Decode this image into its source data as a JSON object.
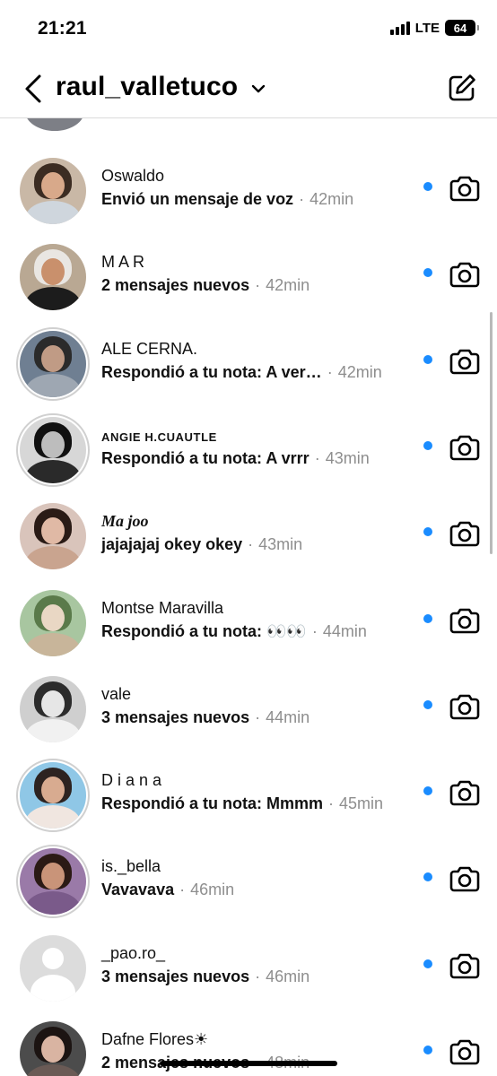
{
  "status_bar": {
    "time": "21:21",
    "network": "LTE",
    "battery": "64"
  },
  "header": {
    "title": "raul_valletuco"
  },
  "conversations": [
    {
      "name": "Oswaldo",
      "message": "Envió un mensaje de voz",
      "time": "42min"
    },
    {
      "name": "M A R",
      "message": "2 mensajes nuevos",
      "time": "42min"
    },
    {
      "name": "ALE CERNA.",
      "message": "Respondió a tu nota: A ver…",
      "time": "42min"
    },
    {
      "name": "ANGIE H.CUAUTLE",
      "message": "Respondió a tu nota: A vrrr",
      "time": "43min"
    },
    {
      "name": "Ma joo",
      "message": "jajajajaj okey okey",
      "time": "43min"
    },
    {
      "name": "Montse Maravilla",
      "message": "Respondió a tu nota: 👀👀",
      "time": "44min"
    },
    {
      "name": "vale",
      "message": "3 mensajes nuevos",
      "time": "44min"
    },
    {
      "name": "D i a n a",
      "message": "Respondió a tu nota: Mmmm",
      "time": "45min"
    },
    {
      "name": "is._bella",
      "message": "Vavavava",
      "time": "46min"
    },
    {
      "name": "_pao.ro_",
      "message": "3 mensajes nuevos",
      "time": "46min"
    },
    {
      "name": "Dafne Flores☀",
      "message": "2 mensajes nuevos",
      "time": "48min"
    }
  ],
  "separator": "·",
  "colors": {
    "unread_dot": "#1a8cff",
    "secondary_text": "#8e8e8e",
    "divider": "#dbdbdb"
  },
  "icons": {
    "back": "chevron-left-icon",
    "account_switch": "chevron-down-icon",
    "compose": "compose-icon",
    "camera": "camera-icon"
  }
}
